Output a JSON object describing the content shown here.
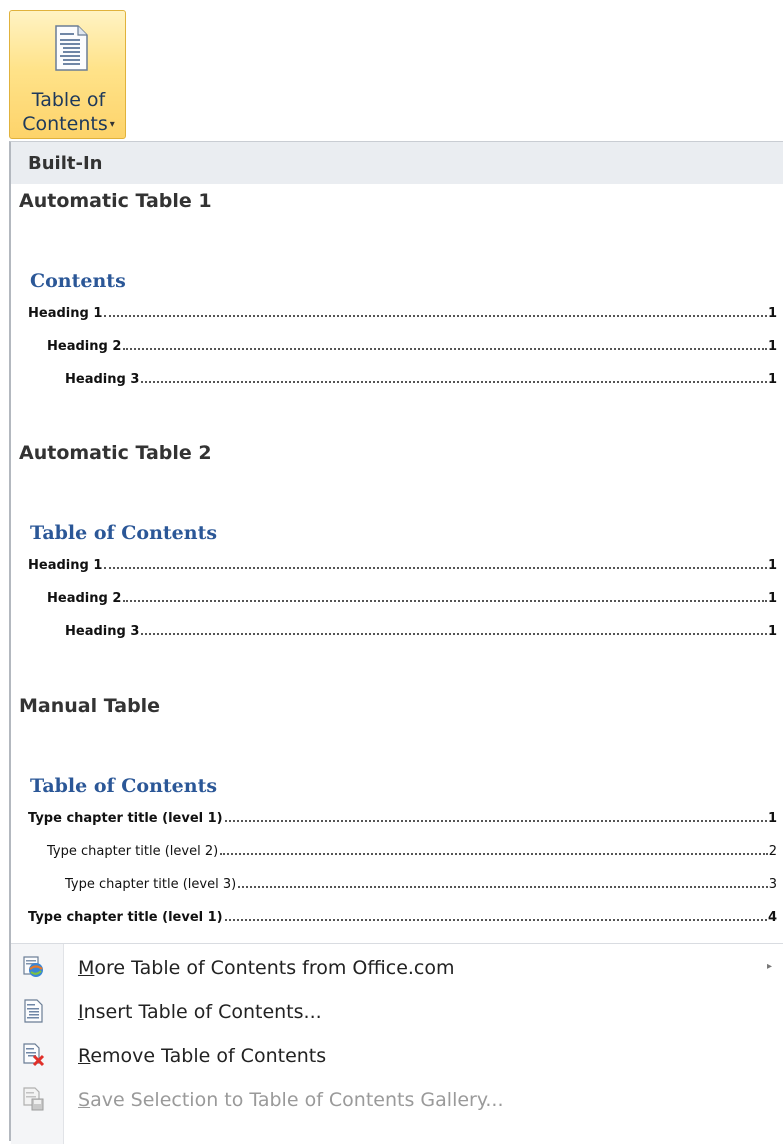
{
  "ribbon_button": {
    "line1": "Table of",
    "line2": "Contents",
    "arrow": "▾",
    "icon": "toc-document-icon"
  },
  "menu": {
    "header": "Built-In",
    "gallery": [
      {
        "title": "Automatic Table 1",
        "heading": "Contents",
        "lines": [
          {
            "text": "Heading 1",
            "page": "1"
          },
          {
            "text": "Heading 2",
            "page": "1"
          },
          {
            "text": "Heading 3",
            "page": "1"
          }
        ]
      },
      {
        "title": "Automatic Table 2",
        "heading": "Table of Contents",
        "lines": [
          {
            "text": "Heading 1",
            "page": "1"
          },
          {
            "text": "Heading 2",
            "page": "1"
          },
          {
            "text": "Heading 3",
            "page": "1"
          }
        ]
      },
      {
        "title": "Manual Table",
        "heading": "Table of Contents",
        "lines": [
          {
            "text": "Type chapter title (level 1)",
            "page": "1"
          },
          {
            "text": "Type chapter title (level 2)",
            "page": "2"
          },
          {
            "text": "Type chapter title (level 3)",
            "page": "3"
          },
          {
            "text": "Type chapter title (level 1)",
            "page": "4"
          }
        ]
      }
    ],
    "commands": [
      {
        "hotkey": "M",
        "rest": "ore Table of Contents from Office.com",
        "icon": "office-web-icon",
        "submenu": "▸",
        "disabled": false
      },
      {
        "hotkey": "I",
        "rest": "nsert Table of Contents...",
        "icon": "insert-toc-icon",
        "disabled": false
      },
      {
        "hotkey": "R",
        "rest": "emove Table of Contents",
        "icon": "remove-toc-icon",
        "disabled": false
      },
      {
        "hotkey": "S",
        "rest": "ave Selection to Table of Contents Gallery...",
        "icon": "save-selection-icon",
        "disabled": true
      }
    ]
  },
  "colors": {
    "heading_blue": "#2b5797",
    "button_gold": "#fdd36a",
    "header_bg": "#eaedf1"
  }
}
